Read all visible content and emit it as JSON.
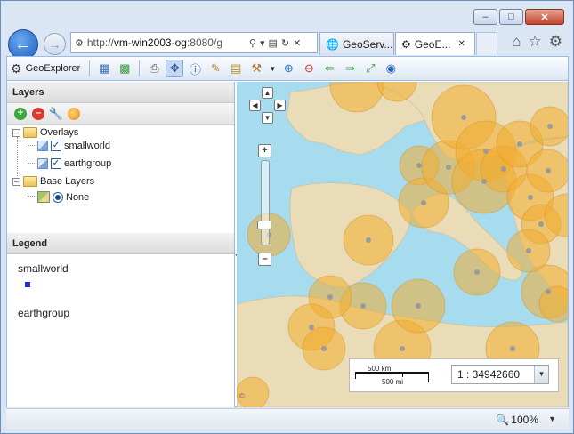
{
  "browser": {
    "url_prefix": "http://",
    "url_host": "vm-win2003-og",
    "url_rest": ":8080/g",
    "tabs": [
      {
        "title": "GeoServ...",
        "active": false
      },
      {
        "title": "GeoE...",
        "active": true
      }
    ],
    "zoom": "100%"
  },
  "app": {
    "title": "GeoExplorer"
  },
  "layers_panel": {
    "title": "Layers",
    "overlays_label": "Overlays",
    "layers": [
      {
        "name": "smallworld",
        "checked": true
      },
      {
        "name": "earthgroup",
        "checked": true
      }
    ],
    "base_layers_label": "Base Layers",
    "base_layers": [
      {
        "name": "None",
        "selected": true
      }
    ]
  },
  "legend_panel": {
    "title": "Legend",
    "entries": [
      {
        "name": "smallworld",
        "color": "#1f2fc9"
      },
      {
        "name": "earthgroup"
      }
    ]
  },
  "map": {
    "scale_km": "500 km",
    "scale_mi": "500 mi",
    "scale_value": "1 : 34942660",
    "feature_color": "#f3ad2f",
    "water_color": "#a7dcef",
    "land_color": "#eadcb7"
  },
  "icons": {
    "back": "arrow-left-icon",
    "forward": "arrow-right-icon",
    "home": "home-icon",
    "favorites": "star-icon",
    "tools": "gear-icon"
  }
}
